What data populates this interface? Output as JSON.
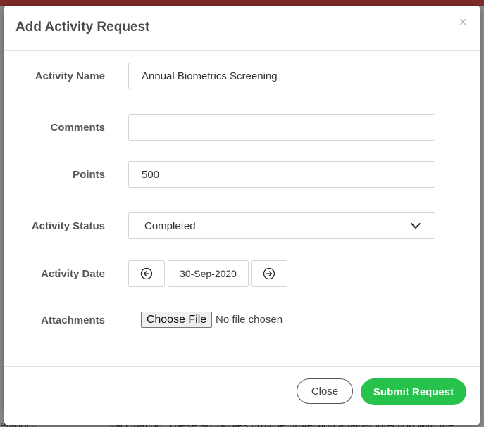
{
  "modal": {
    "title": "Add Activity Request",
    "close_icon": "×"
  },
  "form": {
    "activity_name": {
      "label": "Activity Name",
      "value": "Annual Biometrics Screening"
    },
    "comments": {
      "label": "Comments",
      "value": ""
    },
    "points": {
      "label": "Points",
      "value": "500"
    },
    "activity_status": {
      "label": "Activity Status",
      "selected": "Completed"
    },
    "activity_date": {
      "label": "Activity Date",
      "value": "30-Sep-2020",
      "prev_icon": "arrow-left-circle-icon",
      "next_icon": "arrow-right-circle-icon"
    },
    "attachments": {
      "label": "Attachments",
      "button_label": "Choose File",
      "status": "No file chosen"
    }
  },
  "footer": {
    "close_label": "Close",
    "submit_label": "Submit Request",
    "submit_color": "#27c24c"
  },
  "background": {
    "left_fragment": "etabolic",
    "right_fragment": "vaccination. These antibodies provide protection against infection with the"
  }
}
